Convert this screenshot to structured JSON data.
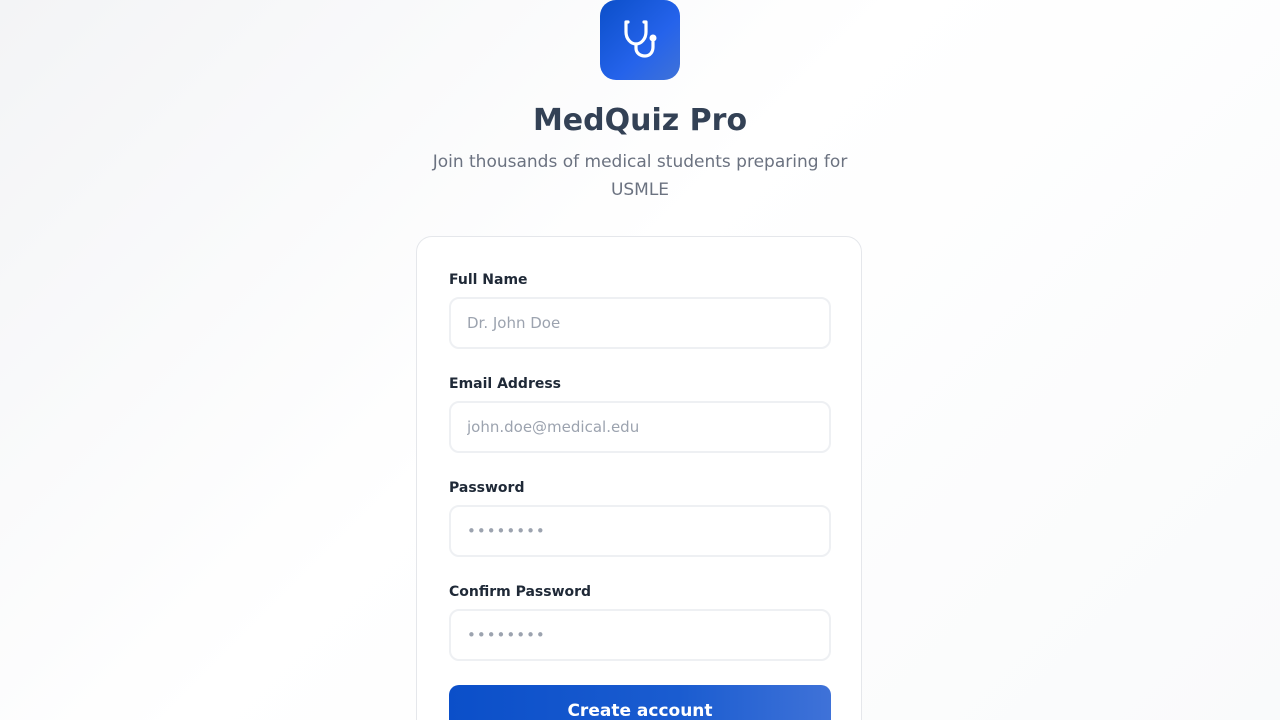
{
  "app": {
    "title": "MedQuiz Pro",
    "subtitle": "Join thousands of medical students preparing for USMLE",
    "logo_icon": "stethoscope-icon"
  },
  "form": {
    "full_name": {
      "label": "Full Name",
      "value": "",
      "placeholder": "Dr. John Doe"
    },
    "email": {
      "label": "Email Address",
      "value": "",
      "placeholder": "john.doe@medical.edu"
    },
    "password": {
      "label": "Password",
      "value": "",
      "placeholder": "••••••••"
    },
    "confirm_password": {
      "label": "Confirm Password",
      "value": "",
      "placeholder": "••••••••"
    },
    "submit_label": "Create account"
  },
  "colors": {
    "brand_primary": "#0b4fc9",
    "brand_secondary": "#3f72d8",
    "title_text": "#334155",
    "subtitle_text": "#6b7280"
  }
}
